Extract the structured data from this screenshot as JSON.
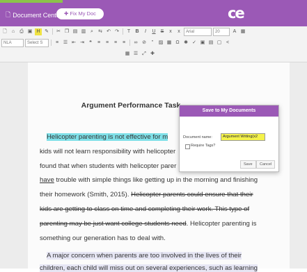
{
  "app": {
    "doc_center_label": "Document Center",
    "doc_center_caret": "▾",
    "fix_button_label": "Fix My Doc",
    "logo_text": "ce"
  },
  "toolbar": {
    "font_value": "Arial",
    "size_value": "20",
    "style_select": "NLA",
    "script_select": "Select S"
  },
  "document": {
    "title": "Argument Performance Task",
    "lines": [
      {
        "parts": [
          {
            "text": "Helicopter parenting is not effective for m",
            "style": "hlcyan"
          }
        ],
        "indent": 10
      },
      {
        "parts": [
          {
            "text": "kids will not learn responsibility with helicopter",
            "style": ""
          }
        ]
      },
      {
        "parts": [
          {
            "text": "found that when students with helicopter parer",
            "style": ""
          }
        ]
      },
      {
        "parts": [
          {
            "text": "have",
            "style": "under"
          },
          {
            "text": " trouble with simple things like getting up in the morning and finishing",
            "style": ""
          }
        ]
      },
      {
        "parts": [
          {
            "text": "their homework (Smith, 2015). ",
            "style": ""
          },
          {
            "text": "Helicopter parents could ensure that their",
            "style": "strike"
          }
        ]
      },
      {
        "parts": [
          {
            "text": "kids are getting to class on time and completing their work. This type of",
            "style": "strike"
          }
        ]
      },
      {
        "parts": [
          {
            "text": "parenting may be just want college students need",
            "style": "strike"
          },
          {
            "text": ".  Helicopter parenting is",
            "style": ""
          }
        ]
      },
      {
        "parts": [
          {
            "text": "something our generation has to deal with.",
            "style": ""
          }
        ]
      },
      {
        "parts": [
          {
            "text": "A major concern when parents are too involved in the lives of their",
            "style": "hllav"
          }
        ],
        "indent": 10
      },
      {
        "parts": [
          {
            "text": "children, each child will miss out on several experiences, such as learning",
            "style": "hllav"
          }
        ]
      }
    ]
  },
  "dialog": {
    "title": "Save to My Documents",
    "name_label": "Document name:",
    "name_value": "Argument Writing(x2",
    "tags_label": "Require Tags?",
    "save_label": "Save",
    "cancel_label": "Cancel"
  }
}
